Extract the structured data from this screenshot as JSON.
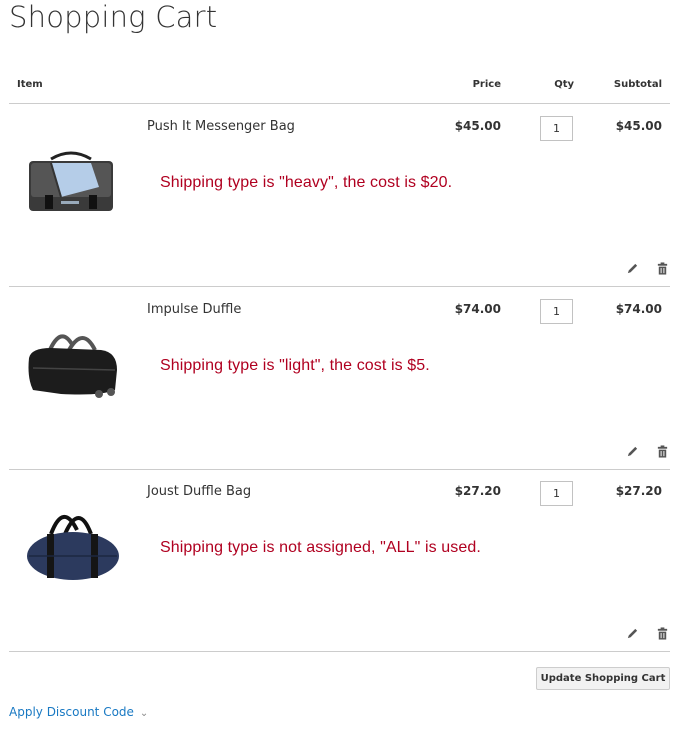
{
  "page": {
    "title": "Shopping Cart"
  },
  "table": {
    "headers": {
      "item": "Item",
      "price": "Price",
      "qty": "Qty",
      "subtotal": "Subtotal"
    }
  },
  "items": [
    {
      "name": "Push It Messenger Bag",
      "price": "$45.00",
      "qty": "1",
      "subtotal": "$45.00",
      "note": "Shipping type is \"heavy\", the cost is $20."
    },
    {
      "name": "Impulse Duffle",
      "price": "$74.00",
      "qty": "1",
      "subtotal": "$74.00",
      "note": "Shipping type is \"light\", the cost is $5."
    },
    {
      "name": "Joust Duffle Bag",
      "price": "$27.20",
      "qty": "1",
      "subtotal": "$27.20",
      "note": "Shipping type is not assigned, \"ALL\" is used."
    }
  ],
  "actions": {
    "update_label": "Update Shopping Cart",
    "discount_label": "Apply Discount Code"
  },
  "colors": {
    "note": "#b00020",
    "link": "#1979c3"
  },
  "icons": {
    "edit": "pencil-icon",
    "delete": "trash-icon",
    "toggle": "chevron-down-icon"
  }
}
